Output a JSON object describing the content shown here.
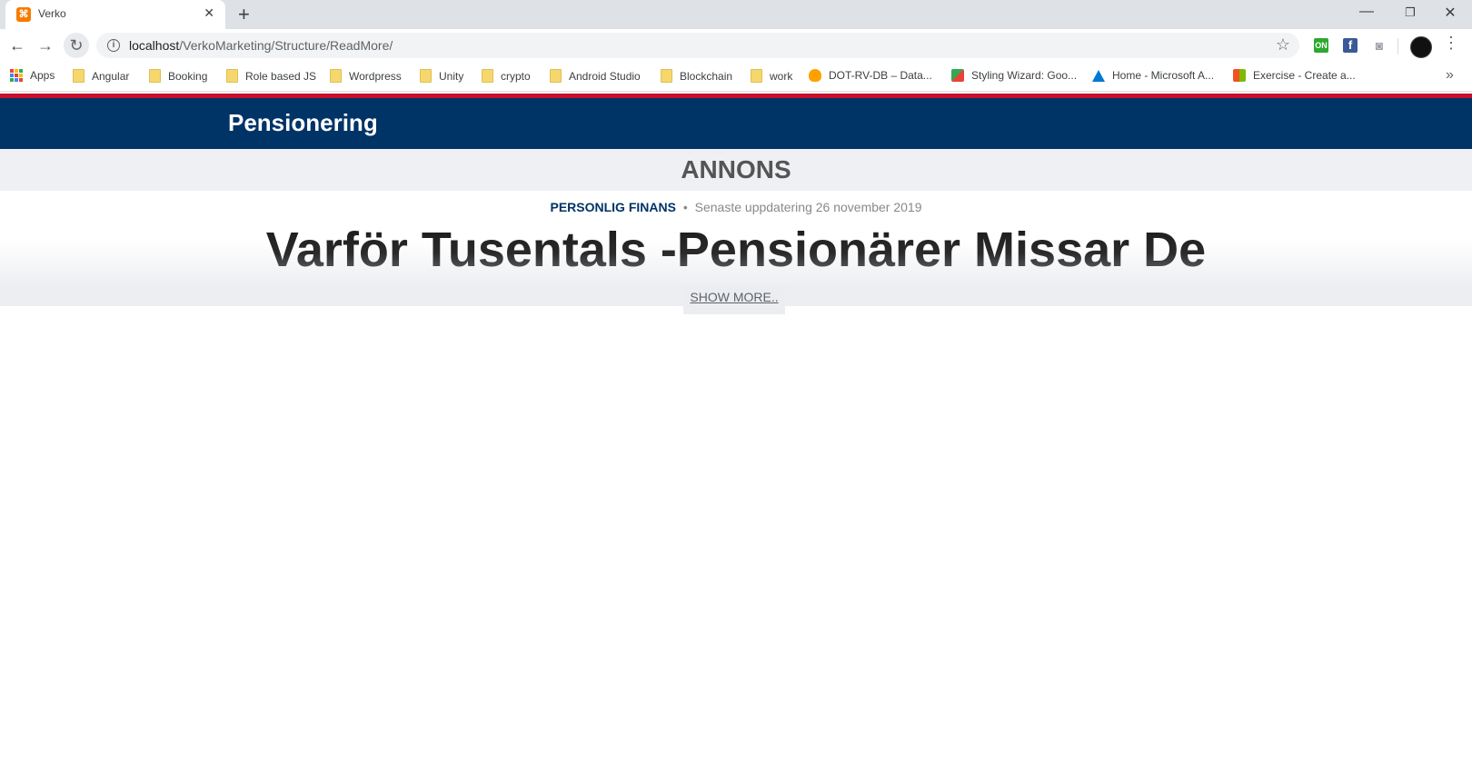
{
  "browser": {
    "tab": {
      "title": "Verko",
      "favicon_color": "#f57c00"
    },
    "new_tab_symbol": "+",
    "url": {
      "host": "localhost",
      "path": "/VerkoMarketing/Structure/ReadMore/"
    },
    "extensions": [
      "on-icon",
      "facebook-icon",
      "camera-icon"
    ],
    "bookmarks": [
      {
        "label": "Apps",
        "icon": "apps-grid-icon"
      },
      {
        "label": "Angular",
        "icon": "folder-icon"
      },
      {
        "label": "Booking",
        "icon": "folder-icon"
      },
      {
        "label": "Role based JS",
        "icon": "folder-icon"
      },
      {
        "label": "Wordpress",
        "icon": "folder-icon"
      },
      {
        "label": "Unity",
        "icon": "folder-icon"
      },
      {
        "label": "crypto",
        "icon": "folder-icon"
      },
      {
        "label": "Android Studio",
        "icon": "folder-icon"
      },
      {
        "label": "Blockchain",
        "icon": "folder-icon"
      },
      {
        "label": "work",
        "icon": "folder-icon"
      },
      {
        "label": "DOT-RV-DB – Data...",
        "icon": "firebase-icon"
      },
      {
        "label": "Styling Wizard: Goo...",
        "icon": "maps-icon"
      },
      {
        "label": "Home - Microsoft A...",
        "icon": "azure-icon"
      },
      {
        "label": "Exercise - Create a...",
        "icon": "microsoft-icon"
      }
    ]
  },
  "page": {
    "brand": "Pensionering",
    "ad_label": "ANNONS",
    "category": "PERSONLIG FINANS",
    "separator": "•",
    "updated": "Senaste uppdatering 26 november 2019",
    "headline": "Varför Tusentals -Pensionärer Missar De",
    "show_more": "SHOW MORE..",
    "colors": {
      "header_bg": "#003366",
      "accent_red": "#c8102e",
      "ad_bg": "#eef0f3"
    }
  }
}
